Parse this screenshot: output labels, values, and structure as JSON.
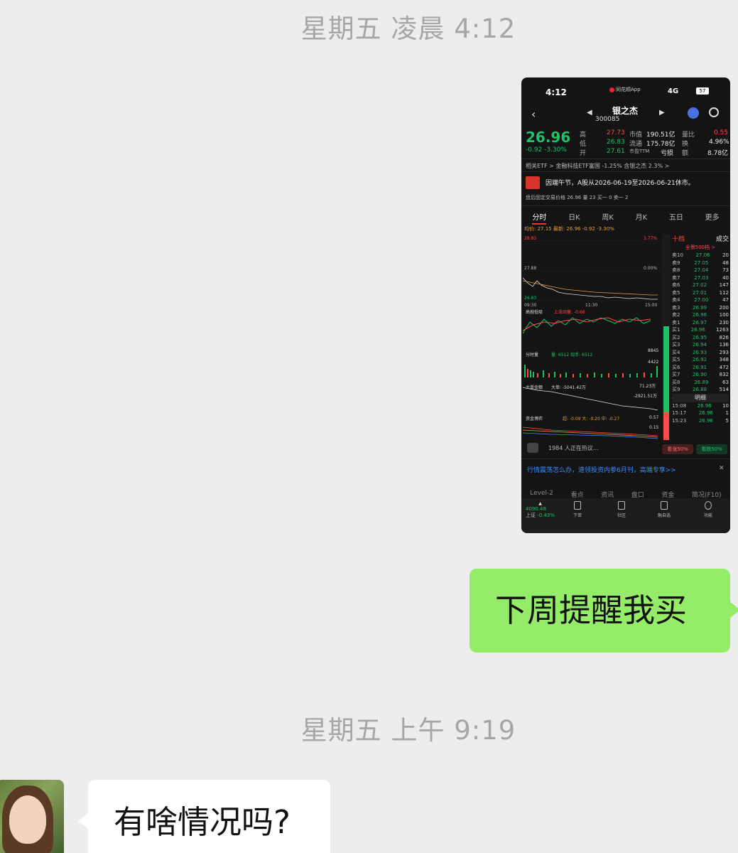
{
  "timestamps": {
    "first": "星期五 凌晨 4:12",
    "second": "星期五 上午 9:19"
  },
  "screenshot": {
    "status_time": "4:12",
    "app_name": "同花顺App",
    "signal": "4G",
    "battery": "57",
    "stock_name": "银之杰",
    "stock_code": "300085",
    "price": "26.96",
    "change": "-0.92  -3.30%",
    "quote": {
      "high_label": "高",
      "high": "27.73",
      "low_label": "低",
      "low": "26.83",
      "open_label": "开",
      "open": "27.61",
      "mktcap_label": "市值",
      "mktcap": "190.51亿",
      "float_label": "流通",
      "float": "175.78亿",
      "pe_label": "市盈TTM",
      "pe": "亏损",
      "vol_ratio_label": "量比",
      "vol_ratio": "0.55",
      "turnover_label": "换",
      "turnover": "4.96%",
      "amount_label": "额",
      "amount": "8.78亿"
    },
    "etf_line": "相关ETF >     金融科技ETF富国 -1.25%    含银之杰 2.3% >",
    "notice": "因端午节，A股从2026-06-19至2026-06-21休市。",
    "after_hours": "盘后固定交易价格  26.96  量 23  买一 0  卖一 2",
    "tabs": [
      "分时",
      "日K",
      "周K",
      "月K",
      "五日",
      "更多"
    ],
    "avg_line": "均价: 27.15  最新: 26.96  -0.92  -3.30%",
    "chart_labels": {
      "top_price": "28.93",
      "mid_price": "27.88",
      "low_price": "26.83",
      "top_pct": "3.77%",
      "mid_pct": "0.00%",
      "time_start": "09:30",
      "time_mid": "11:30",
      "time_end": "15:00",
      "panel1": "高抛低吸",
      "panel1_sub": "上涨动量: -0.68",
      "panel2": "分时量",
      "panel2_sub": "量: 6512  现手: 6512",
      "panel2_val1": "8845",
      "panel2_val2": "4422",
      "panel3": "大单金额",
      "panel3_sub": "大单: -5041.42万",
      "panel3_val1": "71.23万",
      "panel3_val2": "-2921.51万",
      "panel4": "资金博弈",
      "panel4_sub": "超: -0.09  大: -0.20  中: -0.27",
      "panel4_val1": "0.57",
      "panel4_val2": "0.15"
    },
    "orderbook": {
      "tab_active": "十档",
      "tab_other": "成交",
      "sub": "全景500档 >",
      "asks": [
        [
          "卖10",
          "27.06",
          "20"
        ],
        [
          "卖9",
          "27.05",
          "48"
        ],
        [
          "卖8",
          "27.04",
          "73"
        ],
        [
          "卖7",
          "27.03",
          "40"
        ],
        [
          "卖6",
          "27.02",
          "147"
        ],
        [
          "卖5",
          "27.01",
          "112"
        ],
        [
          "卖4",
          "27.00",
          "47"
        ],
        [
          "卖3",
          "26.99",
          "200"
        ],
        [
          "卖2",
          "26.98",
          "100"
        ],
        [
          "卖1",
          "26.97",
          "230"
        ]
      ],
      "bids": [
        [
          "买1",
          "26.96",
          "1263"
        ],
        [
          "买2",
          "26.95",
          "826"
        ],
        [
          "买3",
          "26.94",
          "136"
        ],
        [
          "买4",
          "26.93",
          "293"
        ],
        [
          "买5",
          "26.92",
          "348"
        ],
        [
          "买6",
          "26.91",
          "472"
        ],
        [
          "买7",
          "26.90",
          "832"
        ],
        [
          "买8",
          "26.89",
          "63"
        ],
        [
          "买9",
          "26.88",
          "514"
        ]
      ],
      "detail_label": "明细",
      "ticks": [
        [
          "15:08",
          "26.96",
          "10"
        ],
        [
          "15:17",
          "26.96",
          "1"
        ],
        [
          "15:23",
          "26.96",
          "5"
        ]
      ]
    },
    "discuss": "1984 人正在热议...",
    "bull": "看涨50%",
    "bear": "看跌50%",
    "promo": "行情震荡怎么办，速领投资内参6月刊，高端专享>>",
    "bottom_tabs": [
      "Level-2",
      "看点",
      "资讯",
      "盘口",
      "资金",
      "简况(F10)"
    ],
    "bottom_bar": {
      "index_val": "4090.48",
      "index_name": "上证",
      "index_chg": "-0.43%",
      "items": [
        "下单",
        "社区",
        "融自选",
        "功能"
      ]
    }
  },
  "messages": {
    "self_text": "下周提醒我买",
    "other_text": "有啥情况吗?"
  }
}
